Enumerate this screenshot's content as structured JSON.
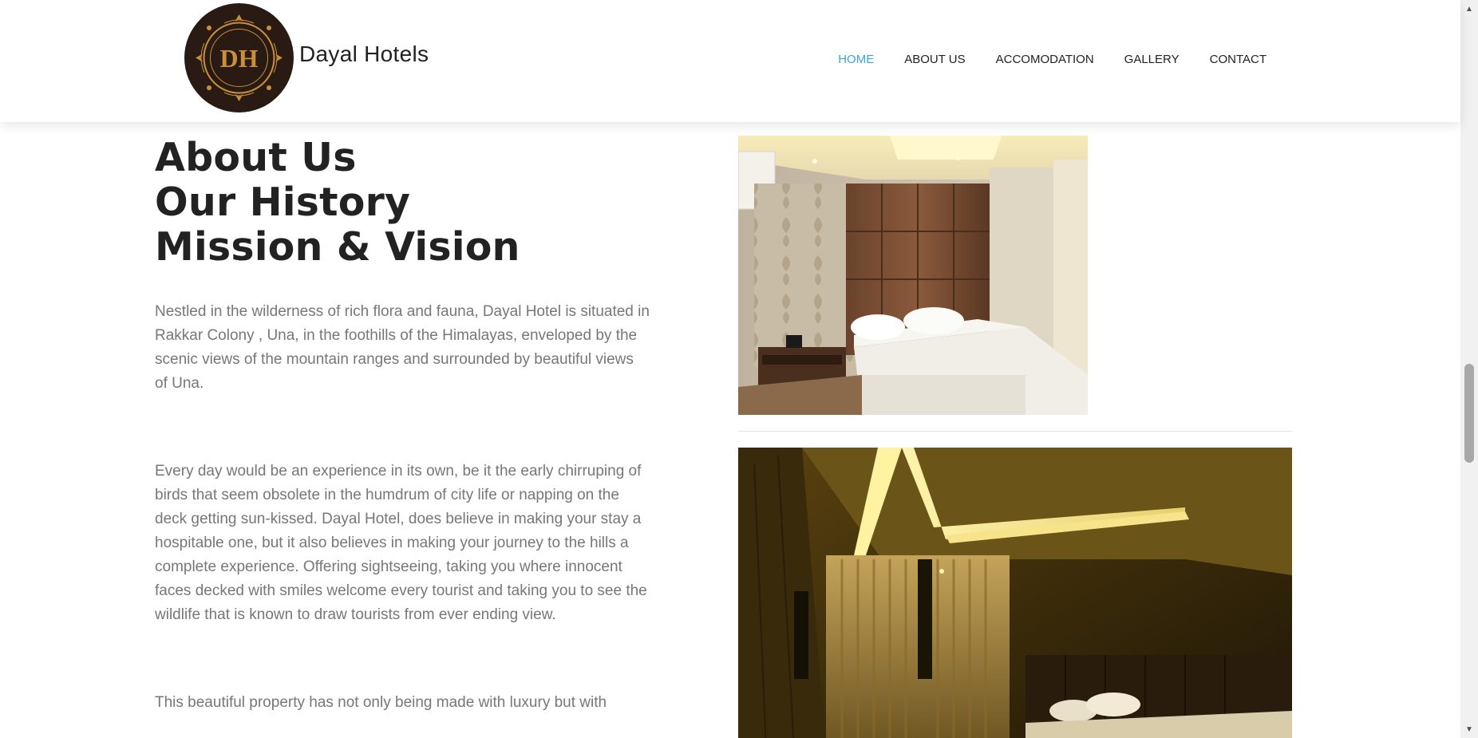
{
  "brand": {
    "name": "Dayal Hotels",
    "logo_monogram": "DH",
    "logo_icon": "hotel-crest-icon"
  },
  "nav": {
    "items": [
      {
        "label": "HOME",
        "active": true
      },
      {
        "label": "ABOUT US",
        "active": false
      },
      {
        "label": "ACCOMODATION",
        "active": false
      },
      {
        "label": "GALLERY",
        "active": false
      },
      {
        "label": "CONTACT",
        "active": false
      }
    ]
  },
  "about": {
    "heading_lines": [
      "About Us",
      "Our History",
      "Mission & Vision"
    ],
    "paragraphs": [
      "Nestled in the wilderness of rich flora and fauna, Dayal Hotel is situated in Rakkar Colony , Una, in the foothills of the Himalayas, enveloped by the scenic views of the mountain ranges and surrounded by beautiful views of Una.",
      "Every day would be an experience in its own, be it the early chirruping of birds that seem obsolete in the humdrum of city life or napping on the deck getting sun-kissed. Dayal Hotel, does believe in making your stay a hospitable one, but it also believes in making your journey to the hills a complete experience. Offering sightseeing, taking you where innocent faces decked with smiles welcome every tourist and taking you to see the wildlife that is known to draw tourists from ever ending view.",
      "This beautiful property has not only being made with luxury but with"
    ]
  },
  "gallery_images": [
    {
      "icon": "bedroom-photo"
    },
    {
      "icon": "dim-bedroom-photo"
    }
  ],
  "colors": {
    "accent": "#3aa6d8",
    "text_dark": "#222222",
    "text_muted": "#777777",
    "logo_bg": "#2a1a14",
    "logo_gold": "#c8903a"
  },
  "scrollbar": {
    "up_icon": "▲",
    "down_icon": "▼"
  }
}
